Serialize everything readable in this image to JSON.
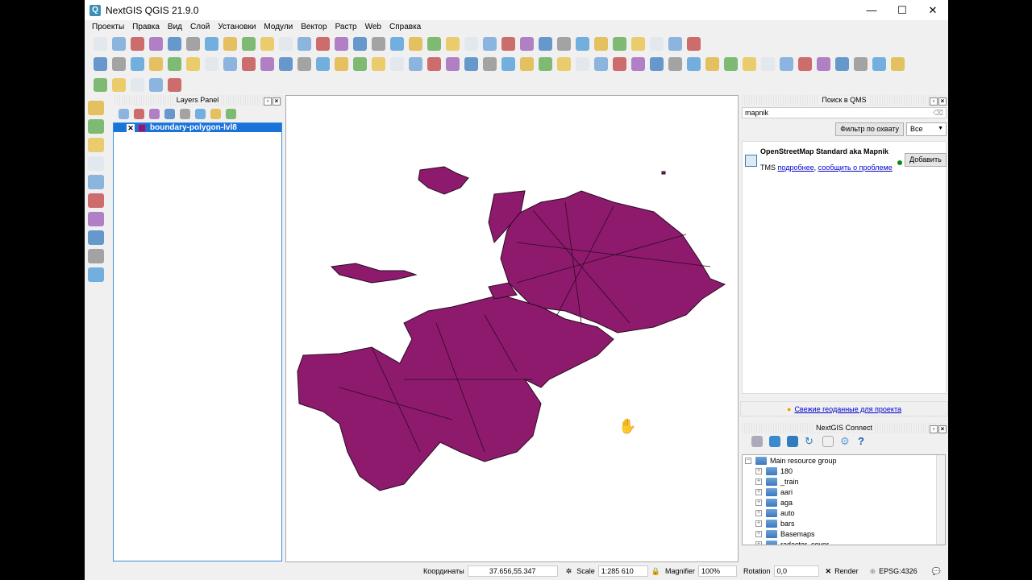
{
  "window": {
    "title": "NextGIS QGIS 21.9.0",
    "minimize": "—",
    "maximize": "☐",
    "close": "✕"
  },
  "menu": [
    "Проекты",
    "Правка",
    "Вид",
    "Слой",
    "Установки",
    "Модули",
    "Вектор",
    "Растр",
    "Web",
    "Справка"
  ],
  "layers_panel": {
    "title": "Layers Panel",
    "layers": [
      {
        "name": "boundary-polygon-lvl8",
        "checked": "✕",
        "color": "#8e1a6e"
      }
    ]
  },
  "qms": {
    "title": "Поиск в QMS",
    "search_value": "mapnik",
    "filter_button": "Фильтр по охвату",
    "filter_select": "Все",
    "result": {
      "title": "OpenStreetMap Standard aka Mapnik",
      "type": "TMS",
      "link_more": "подробнее",
      "link_report": "сообщить о проблеме",
      "add_button": "Добавить",
      "status_color": "#0a8a1a"
    }
  },
  "fresh_data_link": "Свежие геоданные для проекта",
  "ngc": {
    "title": "NextGIS Connect",
    "root": "Main resource group",
    "items": [
      "180",
      "_train",
      "aari",
      "aga",
      "auto",
      "bars",
      "Basemaps",
      "radactor_cover"
    ]
  },
  "status": {
    "coords_label": "Координаты",
    "coords": "37.656,55.347",
    "scale_label": "Scale",
    "scale": "1:285 610",
    "magnifier_label": "Magnifier",
    "magnifier": "100%",
    "rotation_label": "Rotation",
    "rotation": "0,0",
    "render_label": "Render",
    "render_checked": "✕",
    "crs": "EPSG:4326"
  }
}
